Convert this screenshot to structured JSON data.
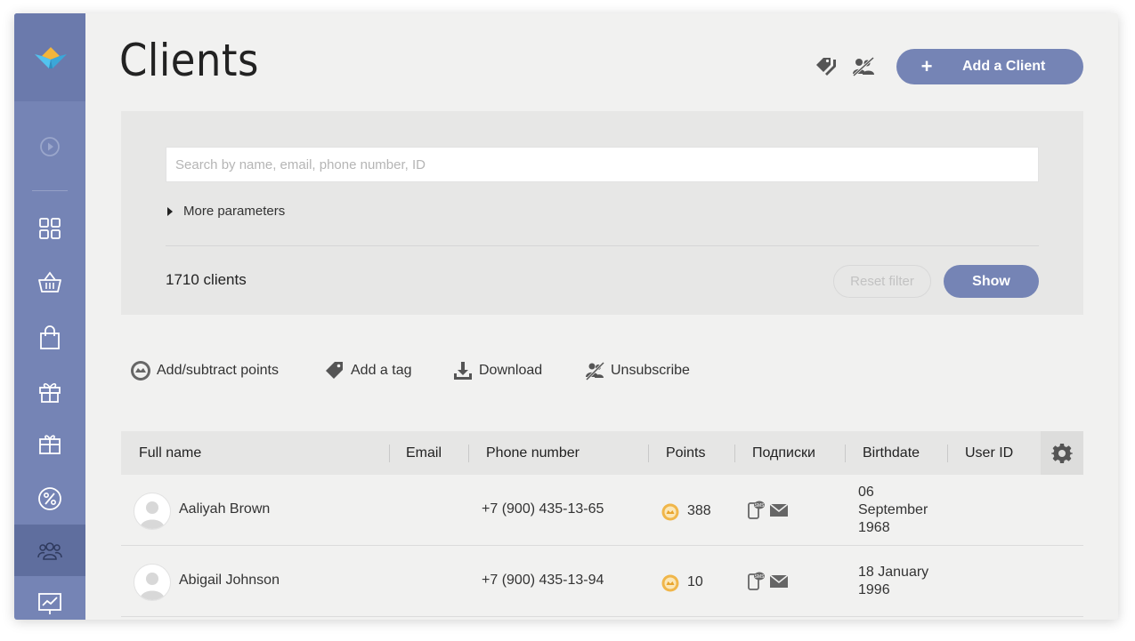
{
  "page": {
    "title": "Clients"
  },
  "header": {
    "add_client_label": "Add a Client",
    "add_client_plus": "+"
  },
  "sidebar": {
    "items": [
      {
        "name": "play-circle-icon"
      },
      {
        "name": "grid-icon"
      },
      {
        "name": "basket-icon"
      },
      {
        "name": "shopping-bag-icon"
      },
      {
        "name": "gift-icon"
      },
      {
        "name": "gift-box-icon"
      },
      {
        "name": "percent-icon"
      },
      {
        "name": "users-icon",
        "active": true
      },
      {
        "name": "chart-icon"
      }
    ]
  },
  "filter": {
    "search_placeholder": "Search by name, email, phone number, ID",
    "more_parameters": "More parameters",
    "clients_count": "1710 clients",
    "reset_label": "Reset filter",
    "show_label": "Show"
  },
  "actions": {
    "points": "Add/subtract points",
    "tag": "Add a tag",
    "download": "Download",
    "unsubscribe": "Unsubscribe"
  },
  "table": {
    "columns": [
      "Full name",
      "Email",
      "Phone number",
      "Points",
      "Подписки",
      "Birthdate",
      "User ID"
    ],
    "rows": [
      {
        "name": "Aaliyah Brown",
        "email": "",
        "phone": "+7 (900) 435-13-65",
        "points": "388",
        "birth_1": "06",
        "birth_2": "September",
        "birth_3": "1968",
        "user_id": ""
      },
      {
        "name": "Abigail Johnson",
        "email": "",
        "phone": "+7 (900) 435-13-94",
        "points": "10",
        "birth_1": "18 January",
        "birth_2": "1996",
        "birth_3": "",
        "user_id": ""
      }
    ]
  },
  "colors": {
    "accent": "#7584b5",
    "sidebar": "#7584b5",
    "coin": "#f0b64a"
  }
}
